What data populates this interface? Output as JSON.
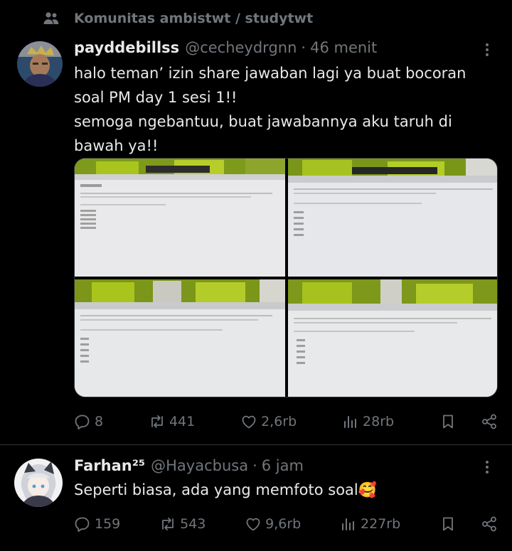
{
  "community": {
    "label": "Komunitas ambistwt / studytwt",
    "icon": "people-icon"
  },
  "tweets": [
    {
      "name": "payddebillss",
      "handle": "@cecheydrgnn",
      "dot": "·",
      "time": "46 menit",
      "lines": [
        "halo teman’ izin share jawaban lagi ya buat bocoran",
        "soal PM day 1 sesi 1!!",
        "semoga ngebantuu, buat jawabannya aku taruh di",
        "bawah ya!!"
      ],
      "media_count": 4,
      "stats": {
        "replies": "8",
        "reposts": "441",
        "likes": "2,6rb",
        "views": "28rb"
      }
    },
    {
      "name": "Farhan²⁵",
      "handle": "@Hayacbusa",
      "dot": "·",
      "time": "6 jam",
      "text": "Seperti biasa, ada yang memfoto soal🥰",
      "stats": {
        "replies": "159",
        "reposts": "543",
        "likes": "9,6rb",
        "views": "227rb"
      }
    }
  ],
  "colors": {
    "background": "#000000",
    "text": "#e7e9ea",
    "muted": "#71767b",
    "divider": "#2f3336"
  }
}
